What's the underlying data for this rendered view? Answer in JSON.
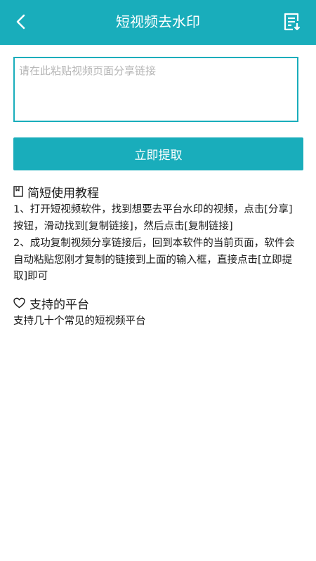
{
  "appbar": {
    "title": "短视频去水印",
    "back_icon": "back-arrow-icon",
    "history_icon": "download-list-icon"
  },
  "input": {
    "placeholder": "请在此粘贴视频页面分享链接",
    "value": ""
  },
  "extract_button": {
    "label": "立即提取"
  },
  "tutorial": {
    "icon": "bookmark-icon",
    "heading": "简短使用教程",
    "steps": [
      "1、打开短视频软件，找到想要去平台水印的视频，点击[分享]按钮，滑动找到[复制链接]，然后点击[复制链接]",
      "2、成功复制视频分享链接后，回到本软件的当前页面，软件会自动粘贴您刚才复制的链接到上面的输入框，直接点击[立即提取]即可"
    ]
  },
  "platforms": {
    "icon": "heart-icon",
    "heading": "支持的平台",
    "description": "支持几十个常见的短视频平台"
  },
  "colors": {
    "primary": "#19adbb",
    "text": "#1a1a1a",
    "placeholder": "#b5b5b5",
    "background": "#ffffff"
  }
}
